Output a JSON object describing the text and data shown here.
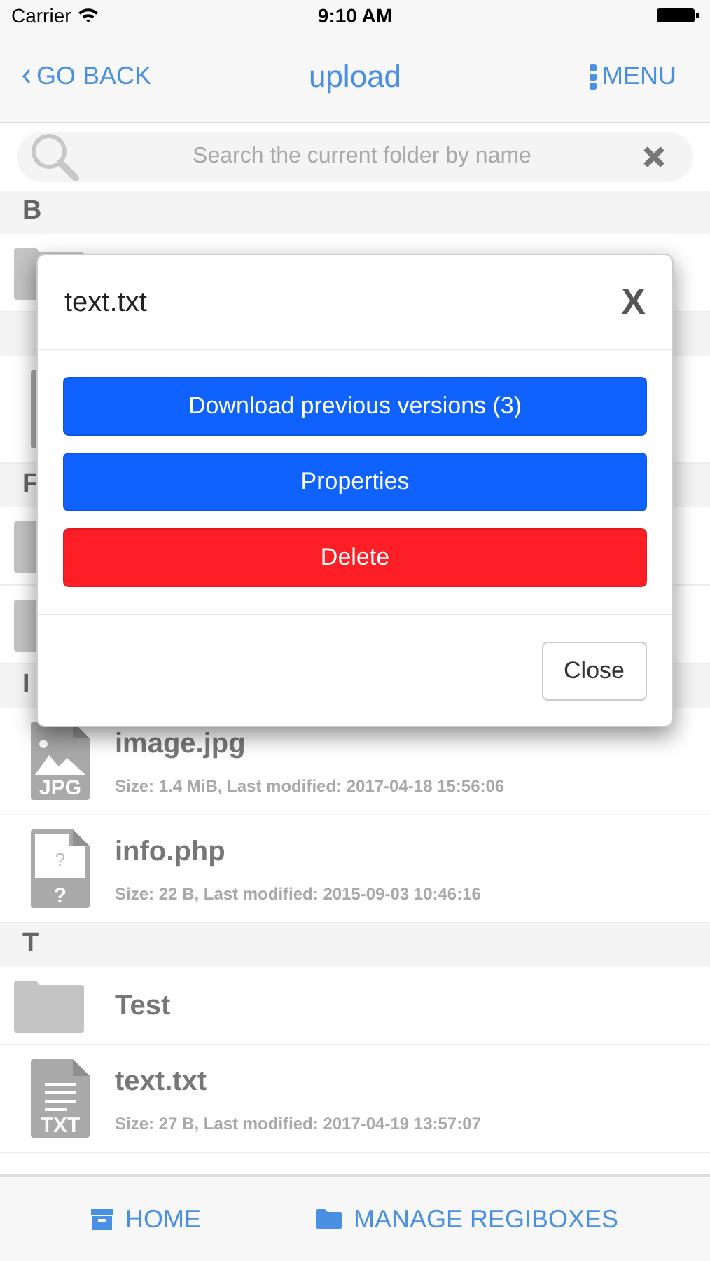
{
  "status_bar": {
    "carrier": "Carrier",
    "time": "9:10 AM"
  },
  "nav": {
    "back": "GO BACK",
    "title": "upload",
    "menu": "MENU"
  },
  "search": {
    "placeholder": "Search the current folder by name"
  },
  "sections": [
    {
      "letter": "B",
      "items": [
        {
          "kind": "folder"
        }
      ]
    },
    {
      "items": [
        {
          "kind": "file"
        }
      ]
    },
    {
      "letter": "F",
      "items": [
        {
          "kind": "folder"
        },
        {
          "kind": "folder"
        }
      ]
    },
    {
      "letter": "I",
      "items": [
        {
          "kind": "image",
          "name": "image.jpg",
          "icon_label": "JPG",
          "meta": "Size: 1.4 MiB, Last modified: 2017-04-18 15:56:06"
        },
        {
          "kind": "unknown",
          "name": "info.php",
          "icon_label": "?",
          "icon_mark": "?",
          "meta": "Size: 22 B, Last modified: 2015-09-03 10:46:16"
        }
      ]
    },
    {
      "letter": "T",
      "items": [
        {
          "kind": "folder",
          "name": "Test"
        },
        {
          "kind": "text",
          "name": "text.txt",
          "icon_label": "TXT",
          "meta": "Size: 27 B, Last modified: 2017-04-19 13:57:07"
        }
      ]
    }
  ],
  "modal": {
    "title": "text.txt",
    "close_glyph": "X",
    "actions": [
      {
        "label": "Download previous versions (3)",
        "kind": "primary"
      },
      {
        "label": "Properties",
        "kind": "primary"
      },
      {
        "label": "Delete",
        "kind": "danger"
      }
    ],
    "close_button": "Close"
  },
  "footer": [
    {
      "label": "HOME",
      "kind": "home"
    },
    {
      "label": "MANAGE REGIBOXES",
      "kind": "folder"
    }
  ]
}
